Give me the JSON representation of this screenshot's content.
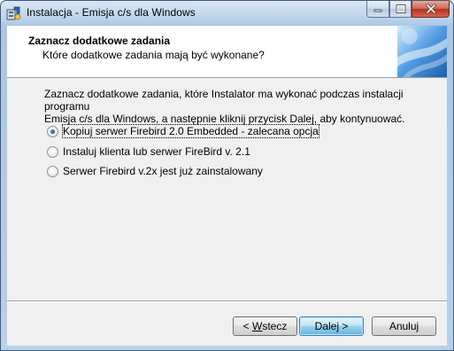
{
  "window": {
    "title": "Instalacja - Emisja c/s dla Windows"
  },
  "header": {
    "title": "Zaznacz dodatkowe zadania",
    "subtitle": "Które dodatkowe zadania mają być wykonane?"
  },
  "description": {
    "line1": "Zaznacz dodatkowe zadania, które Instalator ma wykonać podczas instalacji programu",
    "line2": "Emisja c/s dla Windows, a następnie kliknij przycisk Dalej, aby kontynuować."
  },
  "options": [
    {
      "label": "Kopiuj serwer Firebird 2.0 Embedded - zalecana opcja",
      "selected": true
    },
    {
      "label": "Instaluj klienta lub serwer FireBird v. 2.1",
      "selected": false
    },
    {
      "label": "Serwer Firebird v.2x jest już zainstalowany",
      "selected": false
    }
  ],
  "buttons": {
    "back_prefix": "< ",
    "back_mnemonic": "W",
    "back_rest": "stecz",
    "next": "Dalej >",
    "cancel": "Anuluj"
  },
  "icons": {
    "app": "installer-icon",
    "minimize": "minimize-icon",
    "maximize": "maximize-icon",
    "close": "close-icon"
  }
}
